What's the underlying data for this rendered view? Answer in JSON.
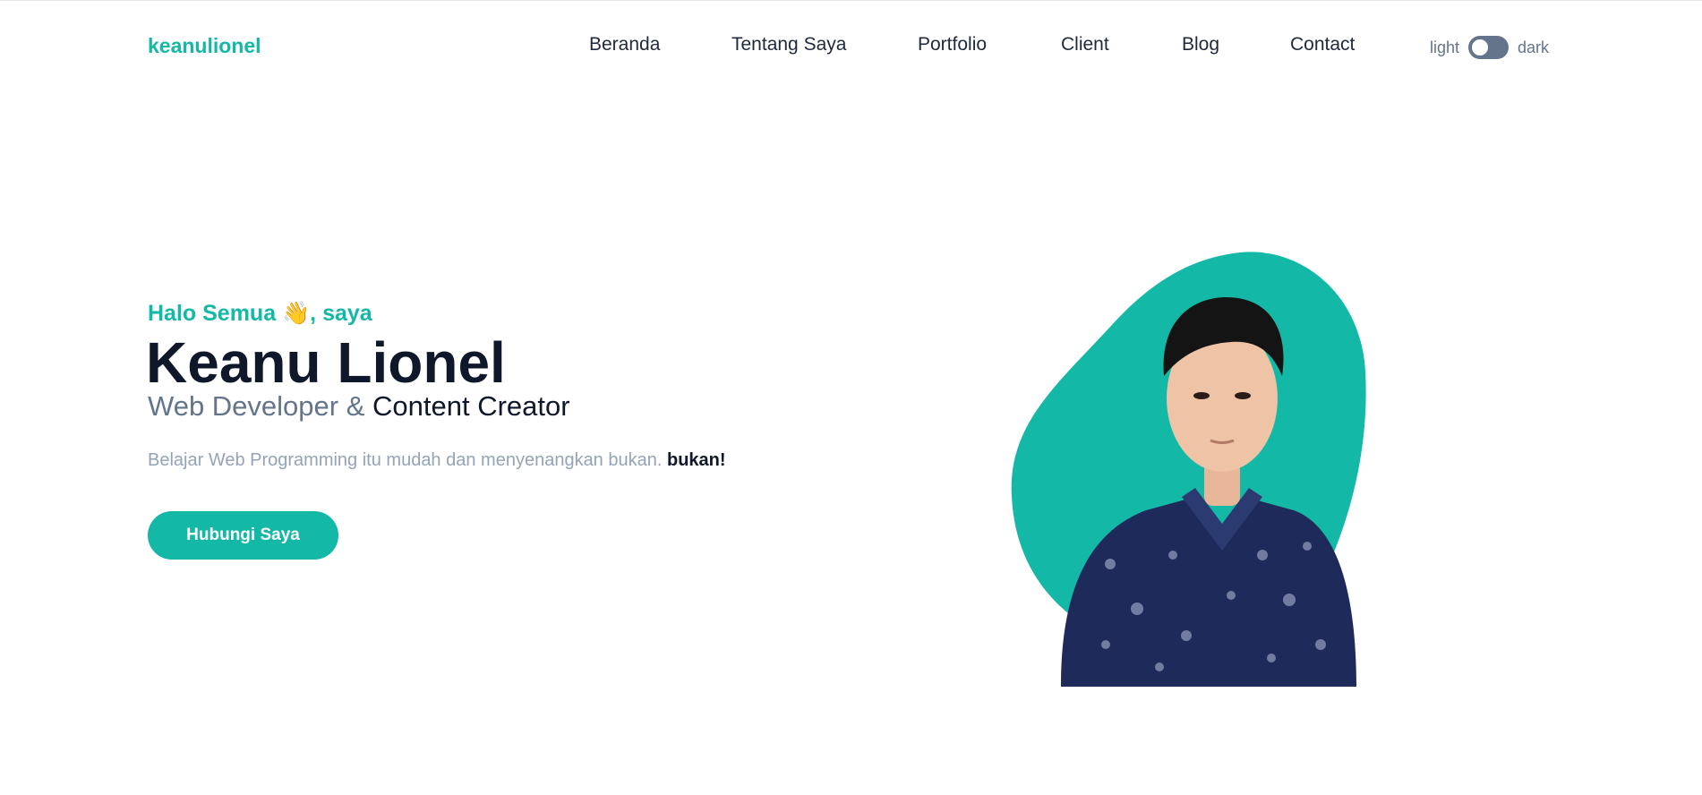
{
  "brand": "keanulionel",
  "nav": {
    "items": [
      "Beranda",
      "Tentang Saya",
      "Portfolio",
      "Client",
      "Blog",
      "Contact"
    ]
  },
  "theme_toggle": {
    "light_label": "light",
    "dark_label": "dark",
    "state": "light"
  },
  "hero": {
    "greeting": "Halo Semua 👋, saya",
    "name": "Keanu Lionel",
    "role_part1": "Web Developer & ",
    "role_part2": "Content Creator",
    "tagline": "Belajar Web Programming itu mudah dan menyenangkan bukan. ",
    "tagline_bold": "bukan!",
    "cta_label": "Hubungi Saya"
  },
  "colors": {
    "accent": "#14b8a6",
    "heading": "#0f172a",
    "muted": "#64748b",
    "light_muted": "#94a3b8",
    "shirt": "#1e2a5a"
  }
}
